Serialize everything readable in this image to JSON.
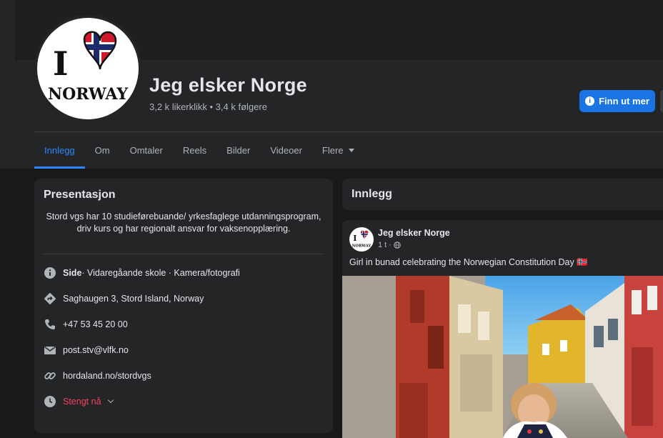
{
  "page": {
    "name": "Jeg elsker Norge",
    "stats": "3,2 k likerklikk • 3,4 k følgere",
    "logo_text": {
      "top": "I",
      "bottom": "NORWAY"
    }
  },
  "cta": {
    "label": "Finn ut mer"
  },
  "tabs": [
    {
      "label": "Innlegg",
      "active": true
    },
    {
      "label": "Om"
    },
    {
      "label": "Omtaler"
    },
    {
      "label": "Reels"
    },
    {
      "label": "Bilder"
    },
    {
      "label": "Videoer"
    },
    {
      "label": "Flere"
    }
  ],
  "intro": {
    "title": "Presentasjon",
    "bio": "Stord vgs har 10 studieførebuande/ yrkesfaglege utdanningsprogram, driv kurs og har regionalt ansvar for vaksenopplæring.",
    "category_prefix": "Side",
    "category_rest": " · Vidaregåande skole · Kamera/fotografi",
    "address": "Saghaugen 3, Stord Island, Norway",
    "phone": "+47 53 45 20 00",
    "email": "post.stv@vlfk.no",
    "website": "hordaland.no/stordvgs",
    "hours": "Stengt nå"
  },
  "posts": {
    "header": "Innlegg",
    "items": [
      {
        "author": "Jeg elsker Norge",
        "time": "1 t",
        "separator": "·",
        "text": "Girl in bunad celebrating the Norwegian Constitution Day 🇳🇴"
      }
    ]
  },
  "colors": {
    "accent": "#2d88ff",
    "cta": "#1b74e4",
    "closed": "#f3425f",
    "card": "#242526",
    "background": "#18191a"
  },
  "icons": {
    "category": "info-icon",
    "address": "directions-icon",
    "phone": "phone-icon",
    "email": "envelope-icon",
    "website": "link-icon",
    "hours": "clock-icon",
    "privacy": "globe-icon"
  }
}
